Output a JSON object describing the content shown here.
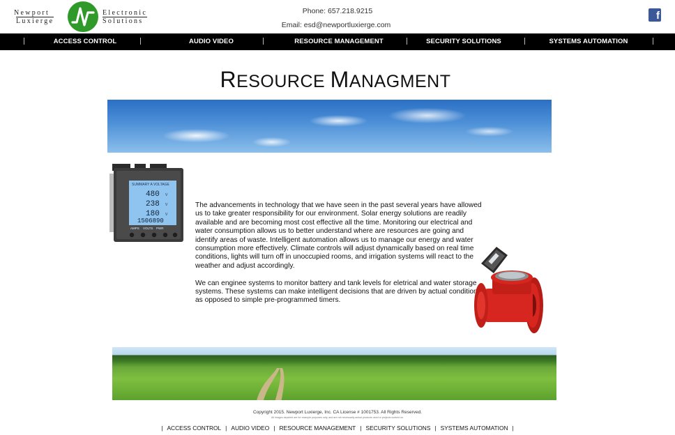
{
  "header": {
    "logo": {
      "left_top": "Newport",
      "left_bottom": "Luxierge",
      "right_top": "Electronic",
      "right_bottom": "Solutions"
    },
    "phone": "Phone: 657.218.9215",
    "email": "Email: esd@newportluxierge.com",
    "social_icon": "facebook-icon",
    "social_glyph": "f"
  },
  "nav": {
    "items": [
      {
        "label": "ACCESS CONTROL"
      },
      {
        "label": "AUDIO VIDEO"
      },
      {
        "label": "RESOURCE MANAGEMENT"
      },
      {
        "label": "SECURITY SOLUTIONS"
      },
      {
        "label": "SYSTEMS AUTOMATION"
      }
    ]
  },
  "page": {
    "title_first_initial": "R",
    "title_first_rest": "ESOURCE ",
    "title_second_initial": "M",
    "title_second_rest": "ANAGMENT"
  },
  "meter_display": {
    "header": "SUMMARY A VOLTAGE",
    "rows": [
      "480",
      "238",
      "180",
      "1506890"
    ],
    "units": [
      "V",
      "V",
      "V"
    ],
    "soft_keys": [
      "AMPS",
      "VOLTS",
      "PWR"
    ]
  },
  "content": {
    "paragraph1": "The advancements in technology that we have seen in the past several years have allowed us to take greater responsibility for our environment. Solar energy solutions are readily available and are becoming most cost effective all the time. Monitoring our electrical and water consumption allows us to better understand where are resources are going and identify areas of waste. Intelligent automation allows us to manage our energy and water consumption more effectively. Climate controls will adjust dynamically based on real time conditions, lights will turn off in unoccupied rooms, and irrigation systems will react to the weather and adjust accordingly.",
    "paragraph2": "We can enginee systems to monitor battery and tank levels for eletrical and water storage systems. These systems can make intelligent decisions that are driven by actual conditions as opposed to simple pre-programmed timers."
  },
  "footer": {
    "copyright": "Copyright 2015. Newport Luxierge, Inc. CA License # 1001753. All Rights Reserved.",
    "fineprint": "All images depicted are for example purposes only, and are not necessarily actual products used or projects worked on.",
    "nav": [
      {
        "label": "ACCESS CONTROL"
      },
      {
        "label": "AUDIO VIDEO"
      },
      {
        "label": "RESOURCE MANAGEMENT"
      },
      {
        "label": "SECURITY SOLUTIONS"
      },
      {
        "label": "SYSTEMS AUTOMATION"
      }
    ],
    "separator": "|"
  },
  "colors": {
    "nav_bg": "#000000",
    "logo_green": "#2f9a2a",
    "facebook_blue": "#3b5998",
    "meter_screen": "#8fc3f0",
    "water_meter_red": "#d7261f"
  }
}
